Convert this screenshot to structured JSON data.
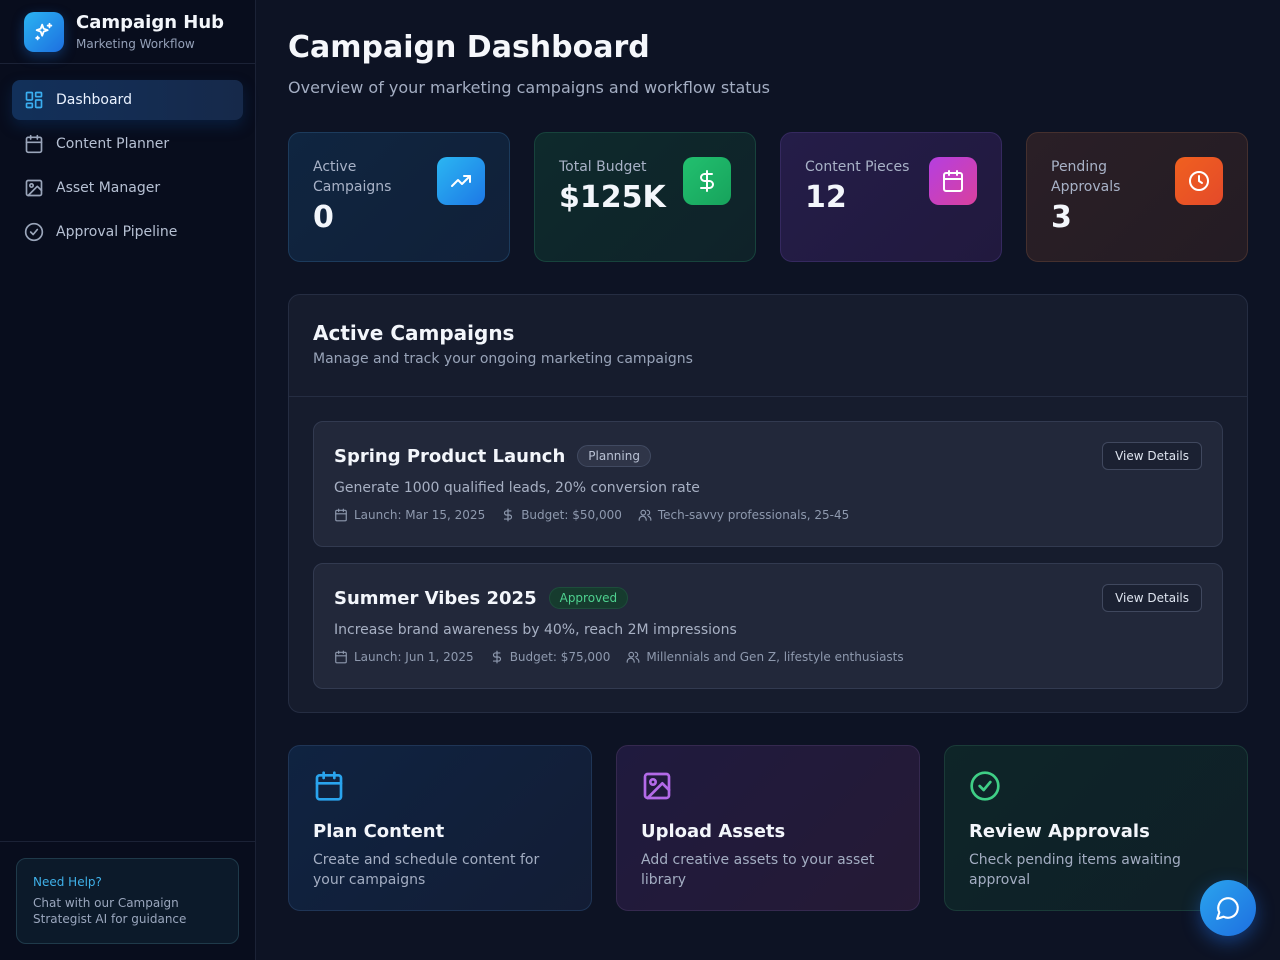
{
  "brand": {
    "title": "Campaign Hub",
    "subtitle": "Marketing Workflow"
  },
  "sidebar": {
    "items": [
      {
        "label": "Dashboard",
        "icon": "grid-icon",
        "active": true
      },
      {
        "label": "Content Planner",
        "icon": "calendar-icon",
        "active": false
      },
      {
        "label": "Asset Manager",
        "icon": "image-icon",
        "active": false
      },
      {
        "label": "Approval Pipeline",
        "icon": "check-circle-icon",
        "active": false
      }
    ],
    "help": {
      "title": "Need Help?",
      "text": "Chat with our Campaign Strategist AI for guidance"
    }
  },
  "header": {
    "title": "Campaign Dashboard",
    "subtitle": "Overview of your marketing campaigns and workflow status"
  },
  "stats": [
    {
      "label": "Active Campaigns",
      "value": "0",
      "icon": "trending-up-icon",
      "accent": "#1e90f0"
    },
    {
      "label": "Total Budget",
      "value": "$125K",
      "icon": "dollar-icon",
      "accent": "#1fb56a"
    },
    {
      "label": "Content Pieces",
      "value": "12",
      "icon": "calendar-icon",
      "accent": "#c03fd8"
    },
    {
      "label": "Pending Approvals",
      "value": "3",
      "icon": "clock-icon",
      "accent": "#ee5724"
    }
  ],
  "campaigns_panel": {
    "title": "Active Campaigns",
    "subtitle": "Manage and track your ongoing marketing campaigns",
    "campaigns": [
      {
        "name": "Spring Product Launch",
        "status": "Planning",
        "goal": "Generate 1000 qualified leads, 20% conversion rate",
        "launch": "Launch: Mar 15, 2025",
        "budget": "Budget: $50,000",
        "audience": "Tech-savvy professionals, 25-45",
        "button": "View Details"
      },
      {
        "name": "Summer Vibes 2025",
        "status": "Approved",
        "goal": "Increase brand awareness by 40%, reach 2M impressions",
        "launch": "Launch: Jun 1, 2025",
        "budget": "Budget: $75,000",
        "audience": "Millennials and Gen Z, lifestyle enthusiasts",
        "button": "View Details"
      }
    ]
  },
  "quick_actions": [
    {
      "title": "Plan Content",
      "text": "Create and schedule content for your campaigns",
      "icon": "calendar-icon",
      "accent": "#2aa4ee"
    },
    {
      "title": "Upload Assets",
      "text": "Add creative assets to your asset library",
      "icon": "image-icon",
      "accent": "#b36ae8"
    },
    {
      "title": "Review Approvals",
      "text": "Check pending items awaiting approval",
      "icon": "check-circle-icon",
      "accent": "#3fcf86"
    }
  ],
  "chat_button": {
    "icon": "chat-bubble-icon"
  }
}
